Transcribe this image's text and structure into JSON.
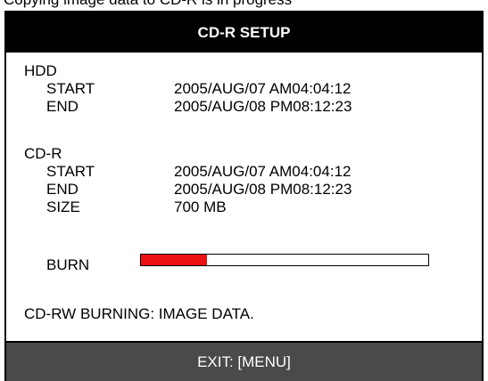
{
  "cut_line": "Copying image data to CD-R is in progress",
  "title": "CD-R SETUP",
  "hdd": {
    "heading": "HDD",
    "start_label": "START",
    "start_value": "2005/AUG/07 AM04:04:12",
    "end_label": "END",
    "end_value": "2005/AUG/08 PM08:12:23"
  },
  "cdr": {
    "heading": "CD-R",
    "start_label": "START",
    "start_value": "2005/AUG/07 AM04:04:12",
    "end_label": "END",
    "end_value": "2005/AUG/08 PM08:12:23",
    "size_label": "SIZE",
    "size_value": "700 MB"
  },
  "burn": {
    "label": "BURN",
    "progress_fraction": 0.23,
    "fill_color": "#ee1111"
  },
  "status": "CD-RW BURNING: IMAGE DATA.",
  "footer": "EXIT: [MENU]",
  "colors": {
    "title_bg": "#000000",
    "footer_bg": "#4a4a4a"
  }
}
